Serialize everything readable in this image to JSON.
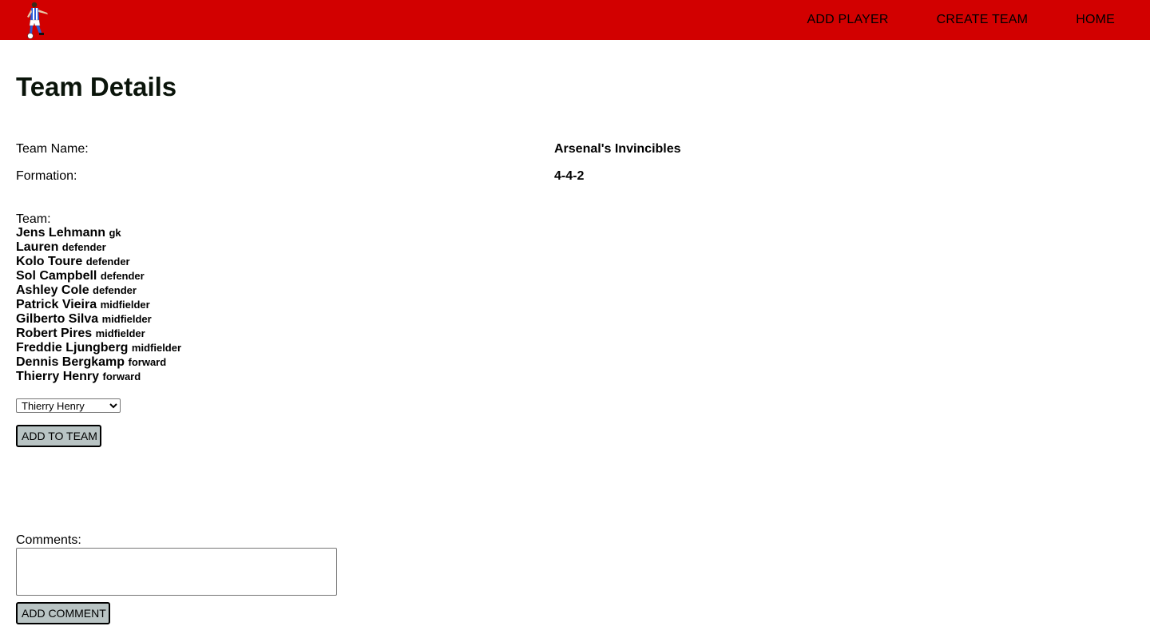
{
  "nav": {
    "logo_icon": "soccer-player-logo-icon",
    "links": [
      {
        "label": "ADD PLAYER"
      },
      {
        "label": "CREATE TEAM"
      },
      {
        "label": "HOME"
      }
    ],
    "background_color": "#d20000"
  },
  "page": {
    "title": "Team Details"
  },
  "details": {
    "team_name_label": "Team Name:",
    "team_name_value": "Arsenal's Invincibles",
    "formation_label": "Formation:",
    "formation_value": "4-4-2"
  },
  "team": {
    "label": "Team:",
    "players": [
      {
        "name": "Jens Lehmann",
        "position": "gk"
      },
      {
        "name": "Lauren",
        "position": "defender"
      },
      {
        "name": "Kolo Toure",
        "position": "defender"
      },
      {
        "name": "Sol Campbell",
        "position": "defender"
      },
      {
        "name": "Ashley Cole",
        "position": "defender"
      },
      {
        "name": "Patrick Vieira",
        "position": "midfielder"
      },
      {
        "name": "Gilberto Silva",
        "position": "midfielder"
      },
      {
        "name": "Robert Pires",
        "position": "midfielder"
      },
      {
        "name": "Freddie Ljungberg",
        "position": "midfielder"
      },
      {
        "name": "Dennis Bergkamp",
        "position": "forward"
      },
      {
        "name": "Thierry Henry",
        "position": "forward"
      }
    ]
  },
  "player_select": {
    "selected": "Thierry Henry",
    "dropdown_icon": "chevron-down-icon"
  },
  "add_to_team_button": "ADD TO TEAM",
  "comments": {
    "label": "Comments:",
    "value": "",
    "button": "ADD COMMENT"
  },
  "colors": {
    "button_bg": "#b9c4c4",
    "title_color": "#0a140a"
  }
}
